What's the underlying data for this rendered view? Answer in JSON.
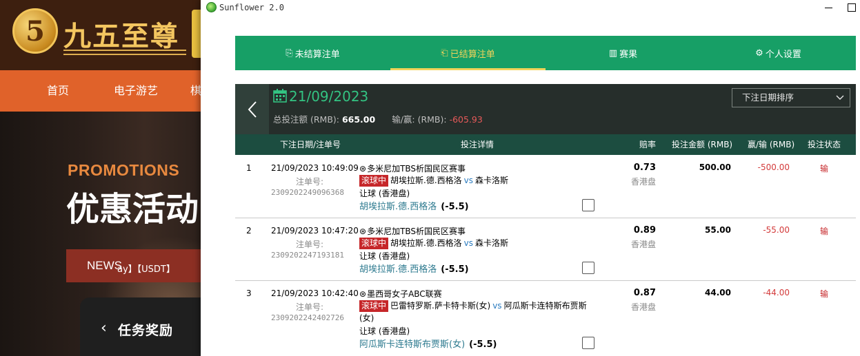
{
  "background_site": {
    "logo_badge": "5",
    "logo_text": "九五至尊",
    "nav": [
      "首页",
      "电子游艺",
      "棋"
    ],
    "promo_en": "PROMOTIONS",
    "promo_cn": "优惠活动",
    "news_label": "NEWS",
    "news_ticker": "ay】【USDT】",
    "task_back": "‹",
    "task_title": "任务奖励"
  },
  "window": {
    "title": "Sunflower 2.0"
  },
  "tabs": [
    {
      "label": "未结算注单",
      "icon": "unsettled-icon",
      "glyph": "⎘"
    },
    {
      "label": "已结算注单",
      "icon": "settled-icon",
      "glyph": "⎗"
    },
    {
      "label": "赛果",
      "icon": "results-icon",
      "glyph": "▥"
    },
    {
      "label": "个人设置",
      "icon": "settings-icon",
      "glyph": "⚙"
    }
  ],
  "active_tab": 1,
  "summary": {
    "date": "21/09/2023",
    "stake_label": "总投注额 (RMB):",
    "stake_value": "665.00",
    "winloss_label": "输/赢: (RMB):",
    "winloss_value": "-605.93",
    "sort_selected": "下注日期排序"
  },
  "columns": {
    "date": "下注日期/注单号",
    "detail": "投注详情",
    "odds": "赔率",
    "stake": "投注金额 (RMB)",
    "winloss": "赢/输 (RMB)",
    "status": "投注状态"
  },
  "bet_id_label": "注单号:",
  "bets": [
    {
      "no": "1",
      "datetime": "21/09/2023 10:49:09",
      "bet_id": "2309202249096368",
      "league": "多米尼加TBS析国民区赛事",
      "live": "滚球中",
      "home": "胡埃拉斯.德.西格洛",
      "vs": "vs",
      "away": "森卡洛斯",
      "match_extra": "",
      "market": "让球 (香港盘)",
      "pick": "胡埃拉斯.德.西格洛",
      "handicap": "(-5.5)",
      "odds": "0.73",
      "odds_type": "香港盘",
      "stake": "500.00",
      "winloss": "-500.00",
      "status": "输"
    },
    {
      "no": "2",
      "datetime": "21/09/2023 10:47:20",
      "bet_id": "2309202247193181",
      "league": "多米尼加TBS析国民区赛事",
      "live": "滚球中",
      "home": "胡埃拉斯.德.西格洛",
      "vs": "vs",
      "away": "森卡洛斯",
      "match_extra": "",
      "market": "让球 (香港盘)",
      "pick": "胡埃拉斯.德.西格洛",
      "handicap": "(-5.5)",
      "odds": "0.89",
      "odds_type": "香港盘",
      "stake": "55.00",
      "winloss": "-55.00",
      "status": "输"
    },
    {
      "no": "3",
      "datetime": "21/09/2023 10:42:40",
      "bet_id": "2309202242402726",
      "league": "墨西哥女子ABC联赛",
      "live": "滚球中",
      "home": "巴雷特罗斯.萨卡特卡斯(女)",
      "vs": "vs",
      "away": "阿瓜斯卡连特斯布贾斯",
      "match_extra": "(女)",
      "market": "让球 (香港盘)",
      "pick": "阿瓜斯卡连特斯布贾斯(女)",
      "handicap": "(-5.5)",
      "odds": "0.87",
      "odds_type": "香港盘",
      "stake": "44.00",
      "winloss": "-44.00",
      "status": "输"
    }
  ],
  "colors": {
    "tab_bg": "#179f66",
    "tab_active": "#f1d35a",
    "summary_bg": "#262e2b",
    "header_bg": "#1c4d40",
    "date_green": "#33c382",
    "loss_red": "#d33a3a",
    "live_badge": "#c6272a"
  }
}
